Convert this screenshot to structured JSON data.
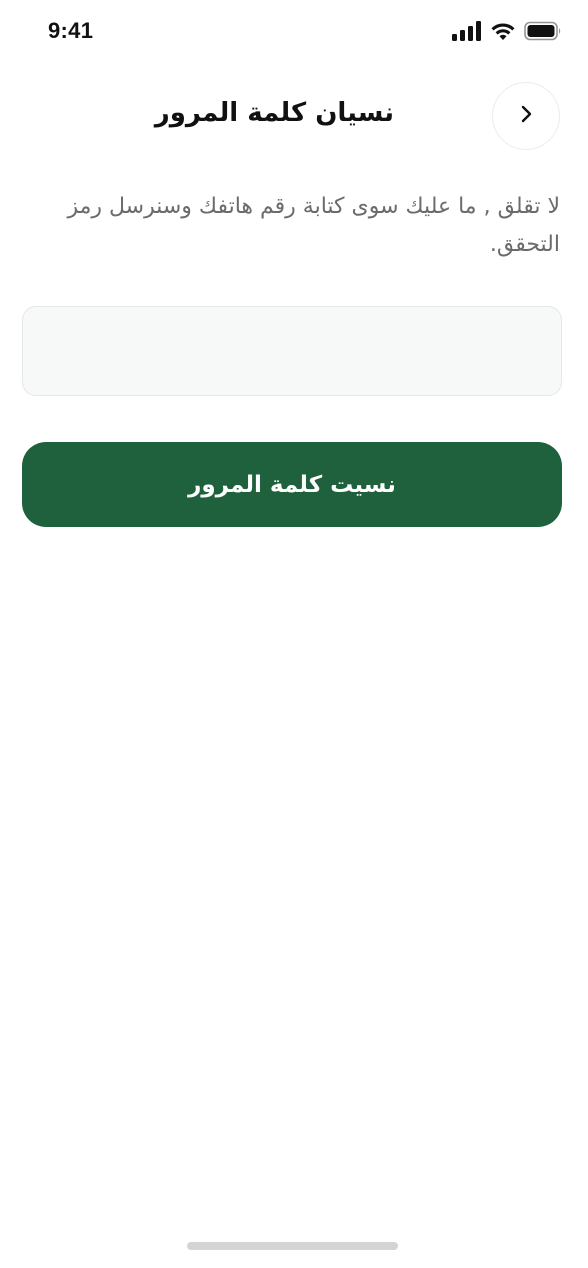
{
  "status_bar": {
    "time": "9:41",
    "icons": [
      "cellular-signal-icon",
      "wifi-icon",
      "battery-icon"
    ]
  },
  "header": {
    "title": "نسيان كلمة المرور",
    "back_icon": "chevron-right-icon"
  },
  "description": "لا تقلق , ما عليك سوى كتابة رقم هاتفك وسنرسل رمز التحقق.",
  "phone_input": {
    "value": "",
    "placeholder": ""
  },
  "submit_button": {
    "label": "نسيت كلمة المرور"
  },
  "colors": {
    "primary": "#1e613c",
    "background": "#ffffff",
    "input_bg": "#f7f8f8",
    "text_primary": "#111111",
    "text_secondary": "#6b6b6b"
  }
}
